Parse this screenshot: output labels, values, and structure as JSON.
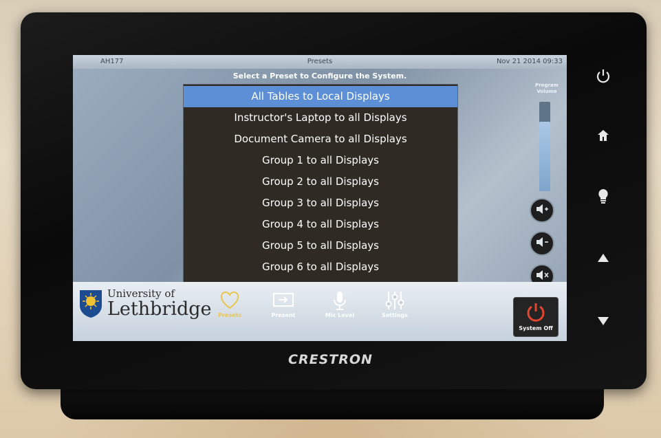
{
  "topbar": {
    "room": "AH177",
    "title": "Presets",
    "clock": "Nov 21 2014 09:33"
  },
  "instruction": "Select a Preset to Configure the System.",
  "presets": [
    "All Tables to Local Displays",
    "Instructor's Laptop to all Displays",
    "Document Camera to all Displays",
    "Group 1 to all Displays",
    "Group 2 to all Displays",
    "Group 3 to all Displays",
    "Group 4 to all Displays",
    "Group 5 to all Displays",
    "Group 6 to all Displays"
  ],
  "selected_preset_index": 0,
  "volume": {
    "label_line1": "Program",
    "label_line2": "Volume",
    "level": 0.78,
    "buttons": [
      "volume-up-icon",
      "volume-down-icon",
      "mute-icon"
    ]
  },
  "logo": {
    "line1": "University of",
    "line2": "Lethbridge"
  },
  "nav": [
    {
      "label": "Presets",
      "icon": "heart-icon",
      "active": true
    },
    {
      "label": "Present",
      "icon": "display-input-icon",
      "active": false
    },
    {
      "label": "Mic Level",
      "icon": "microphone-icon",
      "active": false
    },
    {
      "label": "Settings",
      "icon": "sliders-icon",
      "active": false
    }
  ],
  "system_off": {
    "label": "System Off",
    "icon": "power-icon",
    "color": "#e2462f"
  },
  "hardware_buttons": [
    "power-icon",
    "home-icon",
    "lightbulb-icon",
    "arrow-up-icon",
    "arrow-down-icon"
  ],
  "brand": "CRESTRON",
  "colors": {
    "selected": "#5d8fd6",
    "active_nav": "#e8c64e",
    "list_bg": "#2f2a24"
  }
}
